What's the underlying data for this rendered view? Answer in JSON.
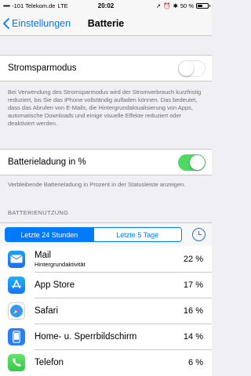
{
  "status_bar": {
    "carrier": "-101 Telekom.de",
    "network": "LTE",
    "time": "20:02",
    "battery_text": "50 %",
    "battery_level": 0.5
  },
  "nav": {
    "back_label": "Einstellungen",
    "title": "Batterie"
  },
  "low_power": {
    "label": "Stromsparmodus",
    "enabled": false,
    "footnote": "Bei Verwendung des Stromsparmodus wird der Stromverbrauch kurzfristig reduziert, bis Sie das iPhone vollständig aufladen können. Das bedeutet, dass das Abrufen von E-Mails, die Hintergrundaktualisierung von Apps, automatische Downloads und einige visuelle Effekte reduziert oder deaktiviert werden."
  },
  "battery_percent": {
    "label": "Batterieladung in %",
    "enabled": true,
    "footnote": "Verbleibende Batterieladung in Prozent in der Statusleiste anzeigen."
  },
  "usage": {
    "section_header": "BATTERIENUTZUNG",
    "segments": [
      "Letzte 24 Stunden",
      "Letzte 5 Tage"
    ],
    "selected_segment": 0,
    "apps": [
      {
        "name": "Mail",
        "subtitle": "Hintergrundaktivität",
        "percent": "22 %",
        "icon": "mail-icon",
        "color": "#1e8cf0"
      },
      {
        "name": "App Store",
        "subtitle": "",
        "percent": "17 %",
        "icon": "app-store-icon",
        "color": "#1a8ef5"
      },
      {
        "name": "Safari",
        "subtitle": "",
        "percent": "16 %",
        "icon": "safari-icon",
        "color": "#ffffff"
      },
      {
        "name": "Home- u. Sperrbildschirm",
        "subtitle": "",
        "percent": "14 %",
        "icon": "iphone-icon",
        "color": "#2b7ef6"
      },
      {
        "name": "Telefon",
        "subtitle": "",
        "percent": "6 %",
        "icon": "phone-icon",
        "color": "#4cd964"
      }
    ]
  },
  "colors": {
    "accent": "#007aff",
    "switch_on": "#4cd964",
    "background": "#efeff4"
  }
}
